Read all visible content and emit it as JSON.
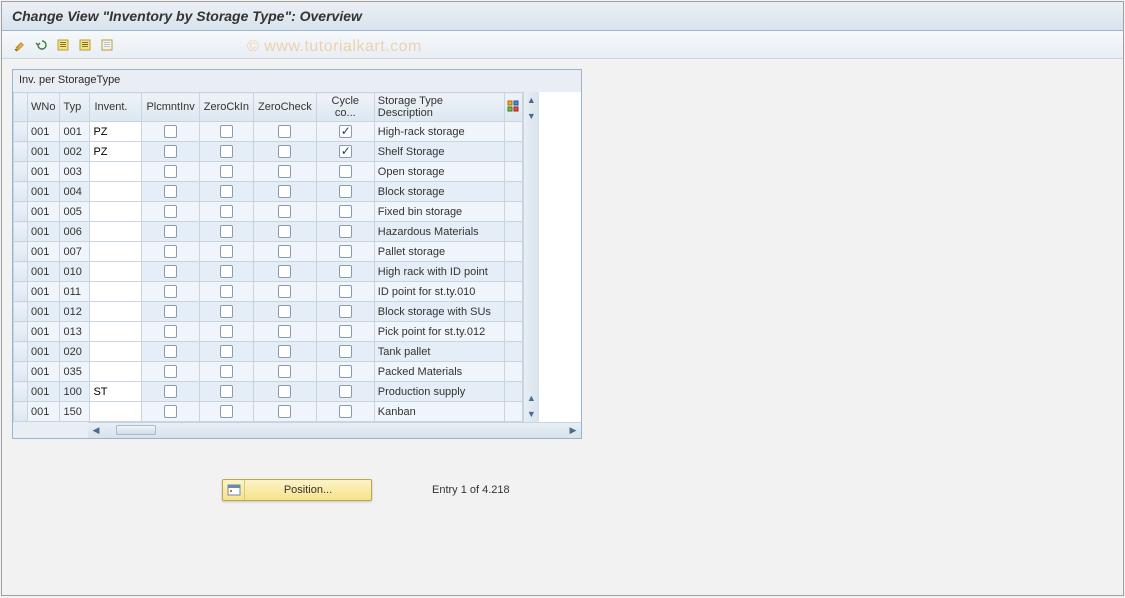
{
  "title": "Change View \"Inventory by Storage Type\": Overview",
  "watermark": "© www.tutorialkart.com",
  "panel_title": "Inv. per StorageType",
  "columns": {
    "wno": "WNo",
    "typ": "Typ",
    "invent": "Invent.",
    "plcmnt": "PlcmntInv",
    "zerockin": "ZeroCkIn",
    "zerocheck": "ZeroCheck",
    "cycle": "Cycle co...",
    "desc": "Storage Type Description"
  },
  "rows": [
    {
      "wno": "001",
      "typ": "001",
      "inv": "PZ",
      "plc": false,
      "zc": false,
      "zck": false,
      "cyc": true,
      "desc": "High-rack storage",
      "editable": true
    },
    {
      "wno": "001",
      "typ": "002",
      "inv": "PZ",
      "plc": false,
      "zc": false,
      "zck": false,
      "cyc": true,
      "desc": "Shelf Storage",
      "editable": true
    },
    {
      "wno": "001",
      "typ": "003",
      "inv": "",
      "plc": false,
      "zc": false,
      "zck": false,
      "cyc": false,
      "desc": "Open storage",
      "editable": true
    },
    {
      "wno": "001",
      "typ": "004",
      "inv": "",
      "plc": false,
      "zc": false,
      "zck": false,
      "cyc": false,
      "desc": "Block storage",
      "editable": true
    },
    {
      "wno": "001",
      "typ": "005",
      "inv": "",
      "plc": false,
      "zc": false,
      "zck": false,
      "cyc": false,
      "desc": "Fixed bin storage",
      "editable": true
    },
    {
      "wno": "001",
      "typ": "006",
      "inv": "",
      "plc": false,
      "zc": false,
      "zck": false,
      "cyc": false,
      "desc": "Hazardous Materials",
      "editable": true
    },
    {
      "wno": "001",
      "typ": "007",
      "inv": "",
      "plc": false,
      "zc": false,
      "zck": false,
      "cyc": false,
      "desc": "Pallet storage",
      "editable": true
    },
    {
      "wno": "001",
      "typ": "010",
      "inv": "",
      "plc": false,
      "zc": false,
      "zck": false,
      "cyc": false,
      "desc": "High rack with ID point",
      "editable": true
    },
    {
      "wno": "001",
      "typ": "011",
      "inv": "",
      "plc": false,
      "zc": false,
      "zck": false,
      "cyc": false,
      "desc": "ID point for st.ty.010",
      "editable": true
    },
    {
      "wno": "001",
      "typ": "012",
      "inv": "",
      "plc": false,
      "zc": false,
      "zck": false,
      "cyc": false,
      "desc": "Block storage with SUs",
      "editable": true
    },
    {
      "wno": "001",
      "typ": "013",
      "inv": "",
      "plc": false,
      "zc": false,
      "zck": false,
      "cyc": false,
      "desc": "Pick point for st.ty.012",
      "editable": true
    },
    {
      "wno": "001",
      "typ": "020",
      "inv": "",
      "plc": false,
      "zc": false,
      "zck": false,
      "cyc": false,
      "desc": "Tank pallet",
      "editable": true
    },
    {
      "wno": "001",
      "typ": "035",
      "inv": "",
      "plc": false,
      "zc": false,
      "zck": false,
      "cyc": false,
      "desc": "Packed Materials",
      "editable": true
    },
    {
      "wno": "001",
      "typ": "100",
      "inv": "ST",
      "plc": false,
      "zc": false,
      "zck": false,
      "cyc": false,
      "desc": "Production supply",
      "editable": true
    },
    {
      "wno": "001",
      "typ": "150",
      "inv": "",
      "plc": false,
      "zc": false,
      "zck": false,
      "cyc": false,
      "desc": "Kanban",
      "editable": true
    }
  ],
  "position_button": "Position...",
  "entry_text": "Entry 1 of 4.218"
}
